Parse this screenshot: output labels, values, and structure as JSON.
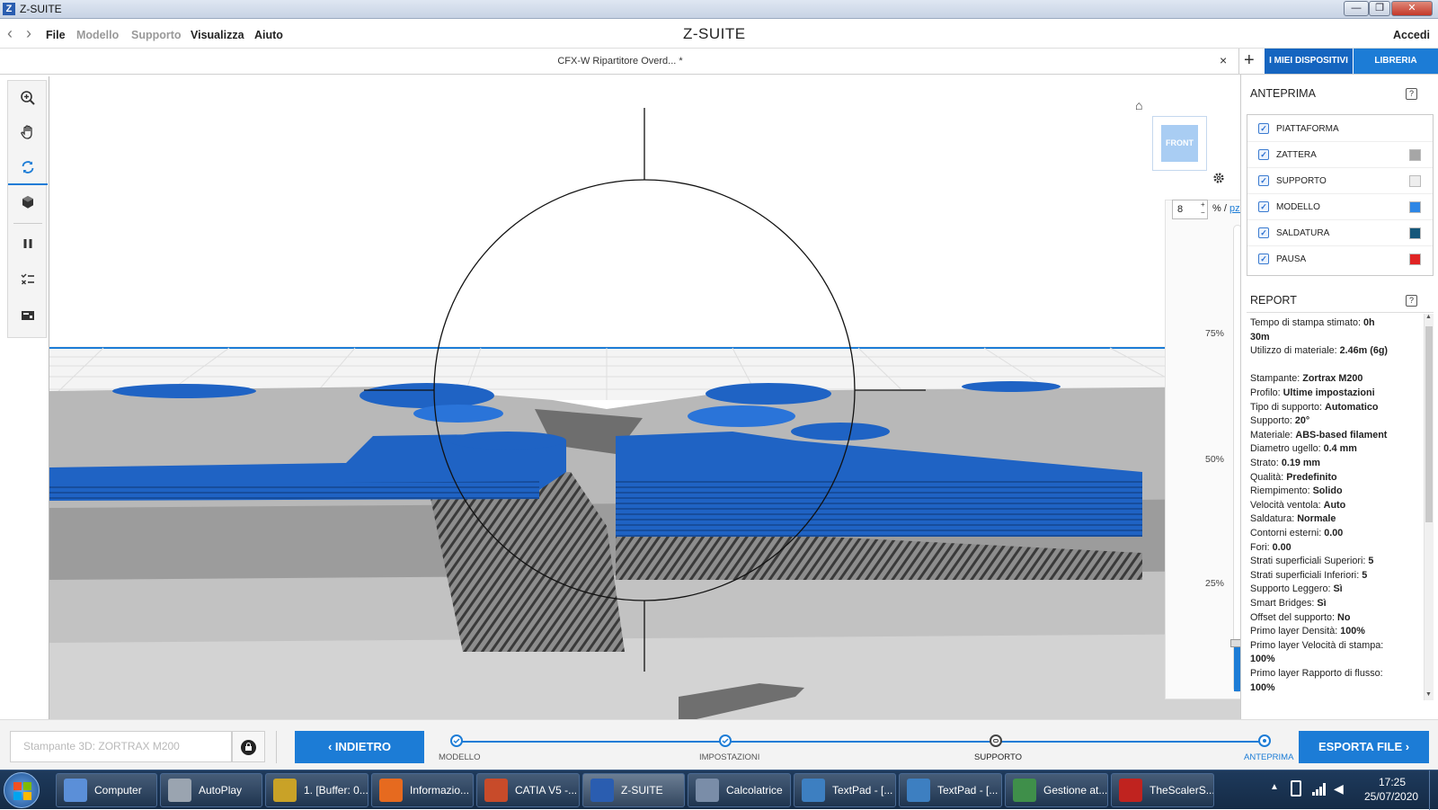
{
  "window": {
    "title": "Z-SUITE",
    "logo_letter": "Z",
    "minimize": "—",
    "restore": "❐",
    "close": "✕"
  },
  "menu": {
    "back": "‹",
    "forward": "›",
    "items": [
      "File",
      "Modello",
      "Supporto",
      "Visualizza",
      "Aiuto"
    ],
    "app_title": "Z-SUITE",
    "login": "Accedi"
  },
  "tabs": {
    "document": "CFX-W Ripartitore Overd... *",
    "close": "×",
    "add": "+",
    "my_devices": "I MIEI DISPOSITIVI",
    "library": "LIBRERIA"
  },
  "toolbar": {
    "icons": [
      "zoom-icon",
      "hand-pan-icon",
      "rotate-icon",
      "view-cube-icon",
      "pause-icon",
      "layers-settings-icon",
      "report-icon"
    ]
  },
  "viewport": {
    "home": "⌂",
    "view_cube": "FRONT",
    "layer_value": "8",
    "unit_percent": "%",
    "unit_sep": " / ",
    "unit_pieces": "pz.",
    "ticks": [
      "75%",
      "50%",
      "25%"
    ],
    "slider_fill": 0.1
  },
  "anteprima": {
    "title": "ANTEPRIMA",
    "help": "?",
    "layers": [
      {
        "label": "PIATTAFORMA",
        "color": null
      },
      {
        "label": "ZATTERA",
        "color": "#a6a6a6"
      },
      {
        "label": "SUPPORTO",
        "color": "#eeeeee"
      },
      {
        "label": "MODELLO",
        "color": "#2e86e5"
      },
      {
        "label": "SALDATURA",
        "color": "#15577a"
      },
      {
        "label": "PAUSA",
        "color": "#e02424"
      }
    ]
  },
  "report": {
    "title": "REPORT",
    "help": "?",
    "lines": [
      {
        "k": "Tempo di stampa stimato: ",
        "v": "0h"
      },
      {
        "k": "",
        "v": "30m"
      },
      {
        "k": "Utilizzo di materiale: ",
        "v": "2.46m (6g)"
      },
      {
        "k": "",
        "v": ""
      },
      {
        "k": "Stampante: ",
        "v": "Zortrax M200"
      },
      {
        "k": "Profilo: ",
        "v": "Ultime impostazioni"
      },
      {
        "k": "Tipo di supporto: ",
        "v": "Automatico"
      },
      {
        "k": "Supporto: ",
        "v": "20°"
      },
      {
        "k": "Materiale: ",
        "v": "ABS-based filament"
      },
      {
        "k": "Diametro ugello: ",
        "v": "0.4 mm"
      },
      {
        "k": "Strato: ",
        "v": "0.19 mm"
      },
      {
        "k": "Qualità: ",
        "v": "Predefinito"
      },
      {
        "k": "Riempimento: ",
        "v": "Solido"
      },
      {
        "k": "Velocità ventola: ",
        "v": "Auto"
      },
      {
        "k": "Saldatura: ",
        "v": "Normale"
      },
      {
        "k": "Contorni esterni: ",
        "v": "0.00"
      },
      {
        "k": "Fori: ",
        "v": "0.00"
      },
      {
        "k": "Strati superficiali Superiori: ",
        "v": "5"
      },
      {
        "k": "Strati superficiali Inferiori: ",
        "v": "5"
      },
      {
        "k": "Supporto Leggero: ",
        "v": "Sì"
      },
      {
        "k": "Smart Bridges: ",
        "v": "Sì"
      },
      {
        "k": "Offset del supporto: ",
        "v": "No"
      },
      {
        "k": "Primo layer Densità: ",
        "v": "100%"
      },
      {
        "k": "Primo layer Velocità di stampa:",
        "v": ""
      },
      {
        "k": "",
        "v": "100%"
      },
      {
        "k": "Primo layer Rapporto di flusso:",
        "v": ""
      },
      {
        "k": "",
        "v": "100%"
      }
    ]
  },
  "bottom": {
    "printer_placeholder": "Stampante 3D: ZORTRAX M200",
    "back": "INDIETRO",
    "export": "ESPORTA FILE",
    "steps": [
      "MODELLO",
      "IMPOSTAZIONI",
      "SUPPORTO",
      "ANTEPRIMA"
    ]
  },
  "taskbar": {
    "apps": [
      {
        "label": "Computer",
        "color": "#5b8fd8"
      },
      {
        "label": "AutoPlay",
        "color": "#9aa4b0"
      },
      {
        "label": "1. [Buffer: 0...",
        "color": "#c9a227"
      },
      {
        "label": "Informazio...",
        "color": "#e66a1f"
      },
      {
        "label": "CATIA V5 -...",
        "color": "#c84b2a"
      },
      {
        "label": "Z-SUITE",
        "color": "#2a5db0"
      },
      {
        "label": "Calcolatrice",
        "color": "#7a8da8"
      },
      {
        "label": "TextPad - [...",
        "color": "#3d7fc1"
      },
      {
        "label": "TextPad - [...",
        "color": "#3d7fc1"
      },
      {
        "label": "Gestione at...",
        "color": "#3f8f4a"
      },
      {
        "label": "TheScalerS...",
        "color": "#c0231f"
      }
    ],
    "time": "17:25",
    "date": "25/07/2020"
  }
}
